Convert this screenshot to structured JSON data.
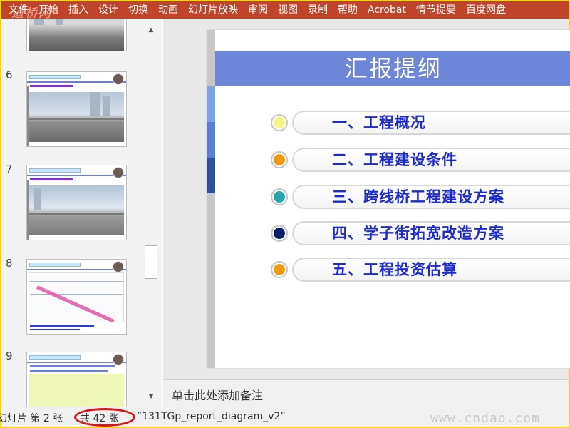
{
  "menu": {
    "items": [
      "文件",
      "开始",
      "插入",
      "设计",
      "切换",
      "动画",
      "幻灯片放映",
      "审阅",
      "视图",
      "录制",
      "帮助",
      "Acrobat",
      "情节提要",
      "百度网盘"
    ],
    "watermark_logo": "道桥网"
  },
  "thumbnails": [
    {
      "number": "6",
      "kind": "photo"
    },
    {
      "number": "7",
      "kind": "photo"
    },
    {
      "number": "8",
      "kind": "map"
    },
    {
      "number": "9",
      "kind": "drawing"
    }
  ],
  "slide": {
    "title": "汇报提纲",
    "outline": [
      {
        "label": "一、工程概况",
        "bullet_color": "#f5f58a"
      },
      {
        "label": "二、工程建设条件",
        "bullet_color": "#f39a12"
      },
      {
        "label": "三、跨线桥工程建设方案",
        "bullet_color": "#2aa6a6"
      },
      {
        "label": "四、学子街拓宽改造方案",
        "bullet_color": "#0b1e66"
      },
      {
        "label": "五、工程投资估算",
        "bullet_color": "#f39a12"
      }
    ],
    "band_colors": [
      "#7fa3e8",
      "#5b7fd4",
      "#2d4f9c"
    ]
  },
  "notes": {
    "placeholder": "单击此处添加备注"
  },
  "status": {
    "slide_label": "幻灯片 第 2 张",
    "total_label": "共 42 张",
    "file_label": "“131TGp_report_diagram_v2”",
    "watermark": "www.cndao.com"
  },
  "colors": {
    "ribbon": "#c0442a",
    "title_bar": "#6c87d8",
    "outline_text": "#1a2ad6"
  }
}
